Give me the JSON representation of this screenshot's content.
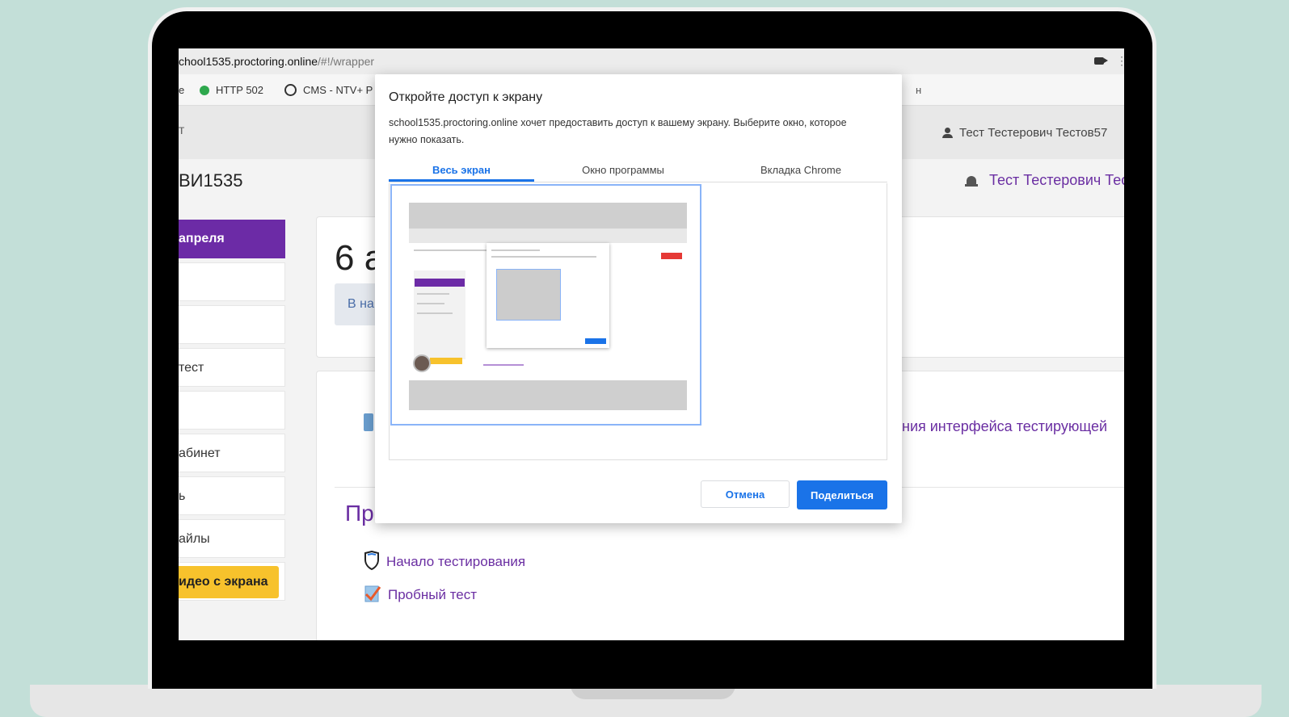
{
  "browser": {
    "url_host": "chool1535.proctoring.online",
    "url_path": "/#!/wrapper",
    "bookmarks": [
      "e",
      "HTTP 502",
      "CMS - NTV+ P"
    ],
    "bookmark_tail": "н"
  },
  "header": {
    "fragment": "т",
    "user_name": "Тест Тестерович Тестов57"
  },
  "page": {
    "org_title": "ВИ1535",
    "user_name_purple": "Тест Тестерович Тес",
    "sidebar": [
      {
        "label": "апреля",
        "active": true
      },
      {
        "label": ""
      },
      {
        "label": ""
      },
      {
        "label": "тест"
      },
      {
        "label": ""
      },
      {
        "label": "абинет"
      },
      {
        "label": "ь"
      },
      {
        "label": "айлы"
      }
    ],
    "screen_record_button": "идео с экрана",
    "date_fragment": "6 а",
    "start_button_fragment": "В на",
    "link_fragment": "ния интерфейса тестирующей",
    "section_title": "Пробный тест",
    "list_items": [
      "Начало тестирования",
      "Пробный тест"
    ]
  },
  "dialog": {
    "title": "Откройте доступ к экрану",
    "message": "school1535.proctoring.online хочет предоставить доступ к вашему экрану. Выберите окно, которое нужно показать.",
    "tabs": [
      "Весь экран",
      "Окно программы",
      "Вкладка Chrome"
    ],
    "active_tab": 0,
    "cancel_label": "Отмена",
    "share_label": "Поделиться"
  },
  "colors": {
    "accent": "#1a73e8",
    "brand_purple": "#6c2ba6",
    "highlight_yellow": "#f7c22c",
    "background": "#c3dfd8"
  }
}
